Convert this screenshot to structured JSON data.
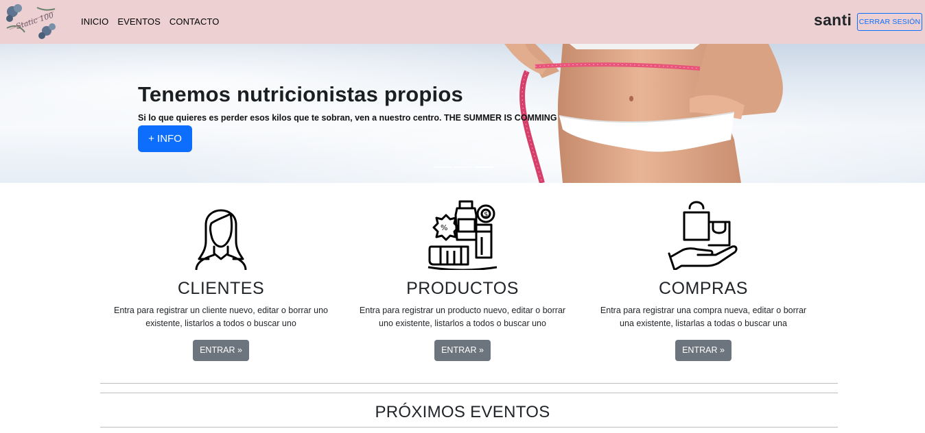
{
  "navbar": {
    "logo_text": "Static 100",
    "links": [
      "INICIO",
      "EVENTOS",
      "CONTACTO"
    ],
    "user": "santi",
    "logout_label": "CERRAR SESIÓN"
  },
  "hero": {
    "title": "Tenemos nutricionistas propios",
    "subtitle": "Si lo que quieres es perder esos kilos que te sobran, ven a nuestro centro. THE SUMMER IS COMMING",
    "button_label": "+ INFO",
    "slides": 3,
    "active_slide": 3
  },
  "cards": [
    {
      "icon": "woman-icon",
      "title": "CLIENTES",
      "text": "Entra para registrar un cliente nuevo, editar o borrar uno existente, listarlos a todos o buscar uno",
      "button": "ENTRAR »"
    },
    {
      "icon": "products-icon",
      "title": "PRODUCTOS",
      "text": "Entra para registrar un producto nuevo, editar o borrar uno existente, listarlos a todos o buscar uno",
      "button": "ENTRAR »"
    },
    {
      "icon": "shopping-hand-icon",
      "title": "COMPRAS",
      "text": "Entra para registrar una compra nueva, editar o borrar una existente, listarlas a todas o buscar una",
      "button": "ENTRAR »"
    }
  ],
  "events": {
    "title": "PRÓXIMOS EVENTOS"
  },
  "colors": {
    "navbar_bg": "#ecd0d2",
    "primary": "#0d6efd",
    "secondary": "#6c757d"
  }
}
